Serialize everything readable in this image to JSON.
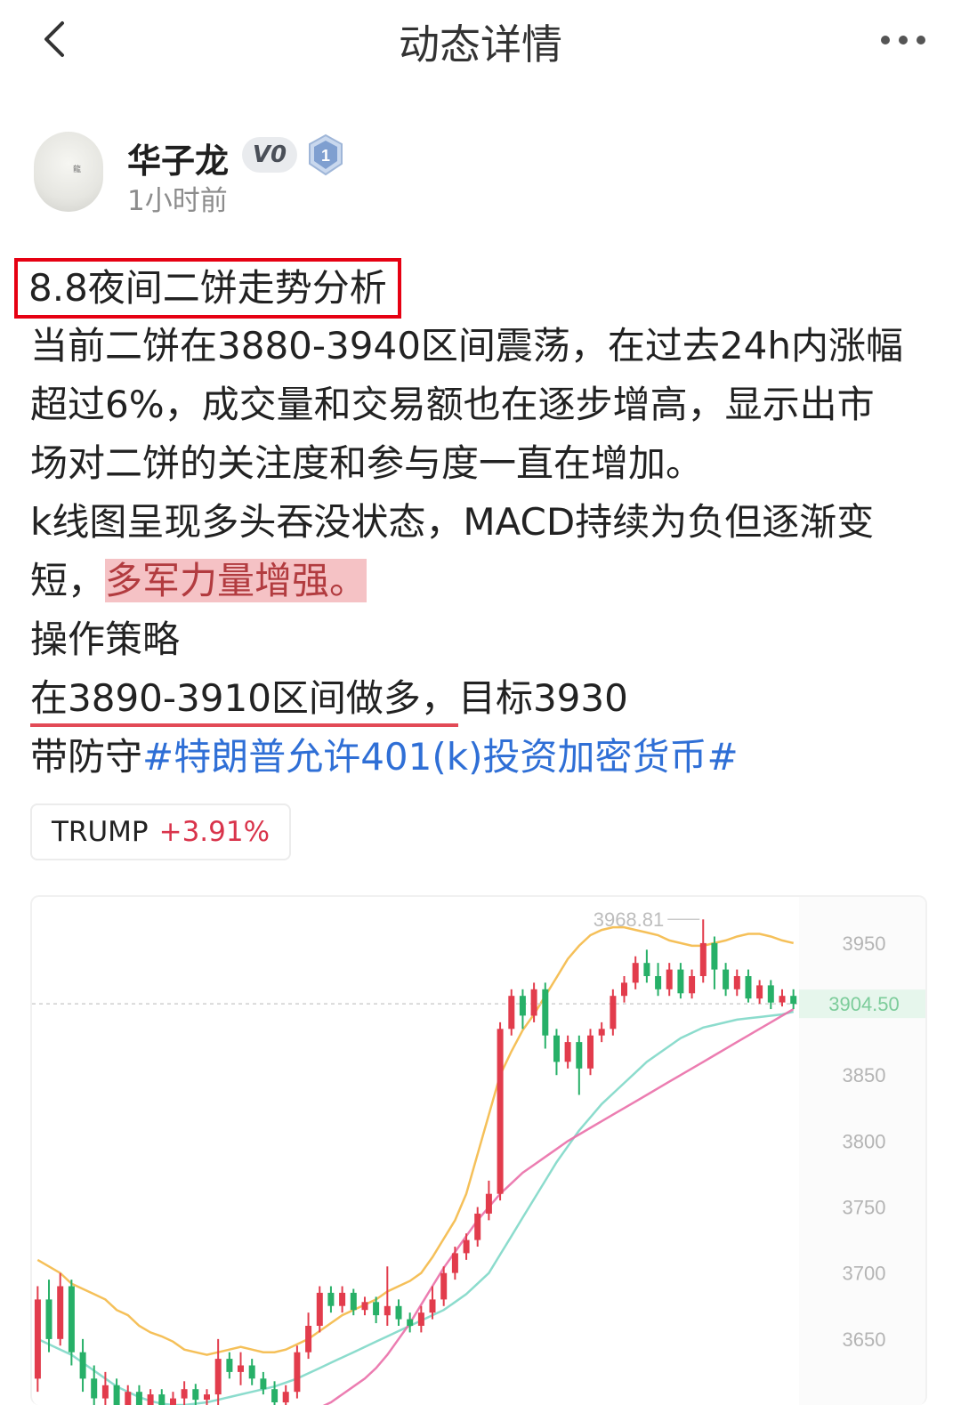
{
  "header": {
    "title": "动态详情",
    "back_icon": "chevron-left-icon",
    "more_icon": "more-horizontal-icon"
  },
  "author": {
    "name": "华子龙",
    "vip_badge": "V0",
    "level_badge": "1",
    "posted_time": "1小时前"
  },
  "post": {
    "headline": "8.8夜间二饼走势分析",
    "line1": "当前二饼在3880-3940区间震荡，在过去24h内涨幅",
    "line2": "超过6%，成交量和交易额也在逐步增高，显示出市",
    "line3": "场对二饼的关注度和参与度一直在增加。",
    "line4": "k线图呈现多头吞没状态，MACD持续为负但逐渐变",
    "line5_prefix": "短，",
    "line5_highlight": "多军力量增强。",
    "line6": "操作策略",
    "line7_underlined": "在3890-3910区间做多，",
    "line7_rest": "目标3930",
    "line8_prefix": "带防守",
    "hashtag": "#特朗普允许401(k)投资加密货币#"
  },
  "ticker": {
    "symbol": "TRUMP",
    "change": "+3.91%"
  },
  "chart_data": {
    "type": "candlestick",
    "high_label": "3968.81",
    "current_price_label": "3904.50",
    "y_ticks": [
      "3950",
      "3900",
      "3850",
      "3800",
      "3750",
      "3700",
      "3650"
    ],
    "y_tick_values": [
      3950,
      3900,
      3850,
      3800,
      3750,
      3700,
      3650
    ],
    "ylim": [
      3600,
      3985
    ],
    "colors": {
      "up": "#e23c4c",
      "down": "#27b068",
      "upper_band": "#f4b947",
      "mid_band": "#7fd8c8",
      "lower_band": "#ea6fa8",
      "price_line": "#cfcfcf"
    },
    "candles": [
      [
        3620,
        3680,
        3610,
        3690
      ],
      [
        3680,
        3650,
        3640,
        3695
      ],
      [
        3650,
        3690,
        3645,
        3700
      ],
      [
        3690,
        3640,
        3630,
        3695
      ],
      [
        3640,
        3620,
        3610,
        3650
      ],
      [
        3620,
        3605,
        3600,
        3630
      ],
      [
        3605,
        3615,
        3600,
        3625
      ],
      [
        3615,
        3600,
        3595,
        3620
      ],
      [
        3600,
        3610,
        3595,
        3615
      ],
      [
        3610,
        3600,
        3598,
        3615
      ],
      [
        3600,
        3608,
        3598,
        3612
      ],
      [
        3608,
        3600,
        3596,
        3612
      ],
      [
        3600,
        3605,
        3598,
        3610
      ],
      [
        3605,
        3612,
        3600,
        3618
      ],
      [
        3612,
        3604,
        3600,
        3616
      ],
      [
        3604,
        3608,
        3600,
        3612
      ],
      [
        3608,
        3635,
        3600,
        3650
      ],
      [
        3635,
        3625,
        3620,
        3640
      ],
      [
        3625,
        3630,
        3615,
        3640
      ],
      [
        3630,
        3620,
        3615,
        3635
      ],
      [
        3620,
        3612,
        3608,
        3625
      ],
      [
        3612,
        3602,
        3598,
        3618
      ],
      [
        3602,
        3610,
        3598,
        3615
      ],
      [
        3610,
        3640,
        3605,
        3645
      ],
      [
        3640,
        3660,
        3635,
        3670
      ],
      [
        3660,
        3685,
        3655,
        3690
      ],
      [
        3685,
        3675,
        3670,
        3690
      ],
      [
        3675,
        3685,
        3670,
        3690
      ],
      [
        3685,
        3672,
        3668,
        3688
      ],
      [
        3672,
        3678,
        3668,
        3682
      ],
      [
        3678,
        3668,
        3662,
        3682
      ],
      [
        3668,
        3675,
        3660,
        3705
      ],
      [
        3675,
        3665,
        3660,
        3680
      ],
      [
        3665,
        3660,
        3655,
        3670
      ],
      [
        3660,
        3670,
        3655,
        3675
      ],
      [
        3670,
        3680,
        3665,
        3690
      ],
      [
        3680,
        3700,
        3675,
        3705
      ],
      [
        3700,
        3715,
        3695,
        3720
      ],
      [
        3715,
        3725,
        3710,
        3730
      ],
      [
        3725,
        3745,
        3720,
        3750
      ],
      [
        3745,
        3760,
        3740,
        3770
      ],
      [
        3760,
        3885,
        3755,
        3890
      ],
      [
        3885,
        3910,
        3880,
        3915
      ],
      [
        3910,
        3895,
        3885,
        3915
      ],
      [
        3895,
        3915,
        3890,
        3920
      ],
      [
        3915,
        3880,
        3870,
        3920
      ],
      [
        3880,
        3860,
        3850,
        3885
      ],
      [
        3860,
        3875,
        3855,
        3880
      ],
      [
        3875,
        3855,
        3835,
        3880
      ],
      [
        3855,
        3880,
        3850,
        3885
      ],
      [
        3880,
        3885,
        3875,
        3890
      ],
      [
        3885,
        3910,
        3880,
        3915
      ],
      [
        3910,
        3920,
        3905,
        3925
      ],
      [
        3920,
        3935,
        3915,
        3940
      ],
      [
        3935,
        3925,
        3920,
        3945
      ],
      [
        3925,
        3915,
        3910,
        3935
      ],
      [
        3915,
        3930,
        3910,
        3935
      ],
      [
        3930,
        3912,
        3908,
        3935
      ],
      [
        3912,
        3925,
        3908,
        3930
      ],
      [
        3925,
        3950,
        3920,
        3968
      ],
      [
        3950,
        3930,
        3915,
        3955
      ],
      [
        3930,
        3915,
        3910,
        3935
      ],
      [
        3915,
        3925,
        3910,
        3930
      ],
      [
        3925,
        3908,
        3905,
        3930
      ],
      [
        3908,
        3918,
        3904,
        3922
      ],
      [
        3918,
        3905,
        3900,
        3922
      ],
      [
        3905,
        3910,
        3902,
        3915
      ],
      [
        3910,
        3904,
        3900,
        3915
      ]
    ],
    "upper_band": [
      3710,
      3705,
      3700,
      3692,
      3688,
      3684,
      3680,
      3672,
      3668,
      3660,
      3655,
      3652,
      3648,
      3642,
      3640,
      3638,
      3640,
      3642,
      3644,
      3642,
      3640,
      3640,
      3642,
      3646,
      3650,
      3656,
      3662,
      3668,
      3672,
      3676,
      3680,
      3686,
      3690,
      3694,
      3700,
      3712,
      3726,
      3740,
      3760,
      3790,
      3820,
      3850,
      3868,
      3884,
      3896,
      3910,
      3924,
      3938,
      3948,
      3956,
      3960,
      3962,
      3962,
      3960,
      3958,
      3956,
      3952,
      3950,
      3948,
      3948,
      3950,
      3952,
      3955,
      3957,
      3957,
      3955,
      3952,
      3950
    ],
    "mid_band": [
      3650,
      3646,
      3642,
      3638,
      3632,
      3626,
      3620,
      3614,
      3610,
      3606,
      3603,
      3601,
      3600,
      3600,
      3601,
      3602,
      3604,
      3606,
      3608,
      3610,
      3612,
      3614,
      3617,
      3620,
      3624,
      3628,
      3632,
      3636,
      3640,
      3644,
      3648,
      3652,
      3656,
      3660,
      3664,
      3668,
      3672,
      3678,
      3684,
      3692,
      3700,
      3714,
      3728,
      3742,
      3756,
      3770,
      3784,
      3796,
      3808,
      3818,
      3828,
      3836,
      3844,
      3852,
      3860,
      3866,
      3872,
      3878,
      3882,
      3886,
      3888,
      3890,
      3892,
      3893,
      3894,
      3895,
      3896,
      3898
    ],
    "lower_band": [
      3560,
      3558,
      3556,
      3555,
      3554,
      3553,
      3553,
      3554,
      3556,
      3558,
      3560,
      3562,
      3563,
      3564,
      3566,
      3568,
      3570,
      3572,
      3574,
      3576,
      3578,
      3582,
      3586,
      3590,
      3594,
      3598,
      3602,
      3608,
      3614,
      3620,
      3628,
      3638,
      3650,
      3662,
      3676,
      3690,
      3704,
      3716,
      3728,
      3740,
      3750,
      3760,
      3768,
      3776,
      3782,
      3788,
      3794,
      3800,
      3805,
      3810,
      3815,
      3820,
      3825,
      3830,
      3835,
      3840,
      3845,
      3850,
      3855,
      3860,
      3865,
      3870,
      3875,
      3880,
      3885,
      3890,
      3895,
      3900
    ]
  }
}
